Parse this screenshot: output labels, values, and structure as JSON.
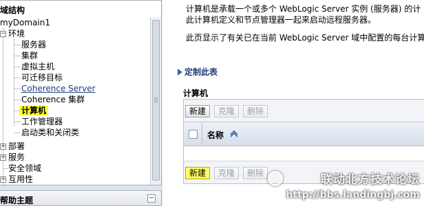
{
  "tree": {
    "header": "域结构",
    "items": [
      {
        "label": "myDomain1",
        "style": "normal"
      },
      {
        "label": "环境",
        "style": "normal"
      },
      {
        "label": "服务器",
        "style": "normal"
      },
      {
        "label": "集群",
        "style": "normal"
      },
      {
        "label": "虚拟主机",
        "style": "normal"
      },
      {
        "label": "可迁移目标",
        "style": "normal"
      },
      {
        "label": "Coherence Server",
        "style": "link"
      },
      {
        "label": "Coherence 集群",
        "style": "normal"
      },
      {
        "label": "计算机",
        "style": "selected"
      },
      {
        "label": "工作管理器",
        "style": "normal"
      },
      {
        "label": "启动类和关闭类",
        "style": "normal"
      },
      {
        "label": "部署",
        "style": "normal"
      },
      {
        "label": "服务",
        "style": "normal"
      },
      {
        "label": "安全领域",
        "style": "normal"
      },
      {
        "label": "互用性",
        "style": "normal"
      }
    ]
  },
  "help": {
    "title": "帮助主题",
    "toggle_symbol": "−"
  },
  "content": {
    "desc_line1": "计算机是承载一个或多个 WebLogic Server 实例 (服务器) 的计",
    "desc_line2": "此计算机定义和节点管理器一起来启动远程服务器。",
    "desc_line3": "此页显示了有关已在当前 WebLogic Server 域中配置的每台计算机",
    "customize_link": "定制此表",
    "section_title": "计算机",
    "buttons_top": {
      "new": "新建",
      "clone": "克隆",
      "delete": "删除"
    },
    "table": {
      "column_name": "名称"
    },
    "buttons_bottom": {
      "new": "新建",
      "clone": "克隆",
      "delete": "删除"
    }
  },
  "watermark": {
    "title": "联动北方技术论坛",
    "url": "http://bbs.landingbj.com"
  },
  "colors": {
    "highlight": "#ffff2e",
    "link": "#1f3b7a",
    "panel_bg": "#dfe3ea"
  }
}
